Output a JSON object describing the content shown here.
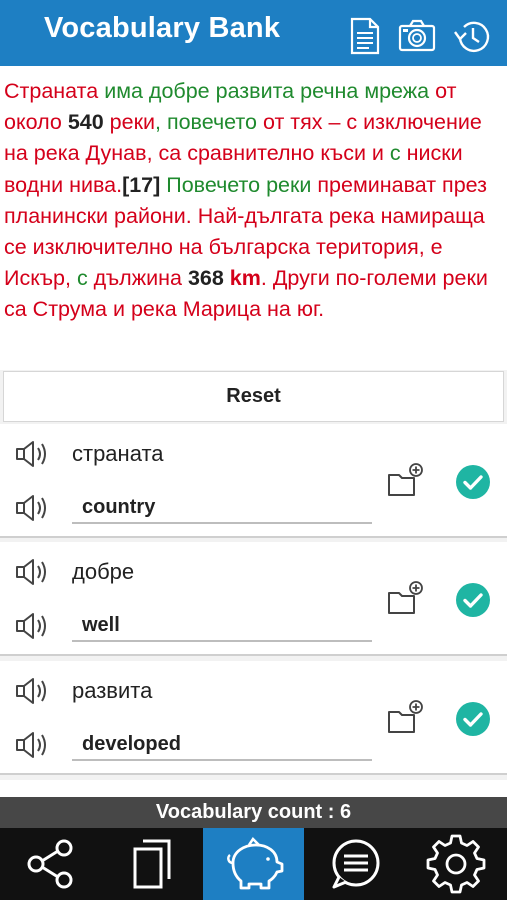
{
  "header": {
    "title": "Vocabulary Bank",
    "icons": [
      "document-icon",
      "camera-icon",
      "history-icon"
    ]
  },
  "passage": {
    "segments": [
      {
        "t": "Страната ",
        "s": "r"
      },
      {
        "t": "има добре развита речна мрежа ",
        "s": "g"
      },
      {
        "t": "от около ",
        "s": "r"
      },
      {
        "t": "540",
        "s": "k"
      },
      {
        "t": " реки",
        "s": "r"
      },
      {
        "t": ", повечето ",
        "s": "g"
      },
      {
        "t": "от ",
        "s": "r"
      },
      {
        "t": "тях – с изключение на река Дунав, са сравнително къси и ",
        "s": "r"
      },
      {
        "t": "с",
        "s": "g"
      },
      {
        "t": " ниски водни нива.",
        "s": "r"
      },
      {
        "t": "[17]",
        "s": "k"
      },
      {
        "t": " Повечето реки ",
        "s": "g"
      },
      {
        "t": "преминават през планински райони. Най-дългата река намираща се изключително на българска територия, е Искър, ",
        "s": "r"
      },
      {
        "t": "с",
        "s": "g"
      },
      {
        "t": " дължина ",
        "s": "r"
      },
      {
        "t": "368",
        "s": "k"
      },
      {
        "t": " ",
        "s": "r"
      },
      {
        "t": "km",
        "s": "rb"
      },
      {
        "t": ". Други по-големи реки са Струма и река Марица на юг.",
        "s": "r"
      }
    ]
  },
  "reset_label": "Reset",
  "vocab": [
    {
      "word": "страната",
      "translation": "country"
    },
    {
      "word": "добре",
      "translation": "well"
    },
    {
      "word": "развита",
      "translation": "developed"
    }
  ],
  "count_label": "Vocabulary count : 6",
  "nav": [
    {
      "icon": "share-icon",
      "active": false
    },
    {
      "icon": "copy-icon",
      "active": false
    },
    {
      "icon": "piggy-bank-icon",
      "active": true
    },
    {
      "icon": "chat-icon",
      "active": false
    },
    {
      "icon": "gear-icon",
      "active": false
    }
  ],
  "colors": {
    "accent": "#1e7fc3",
    "passage_red": "#d4001a",
    "passage_green": "#1f8a2e",
    "check_teal": "#1fb5a3"
  }
}
